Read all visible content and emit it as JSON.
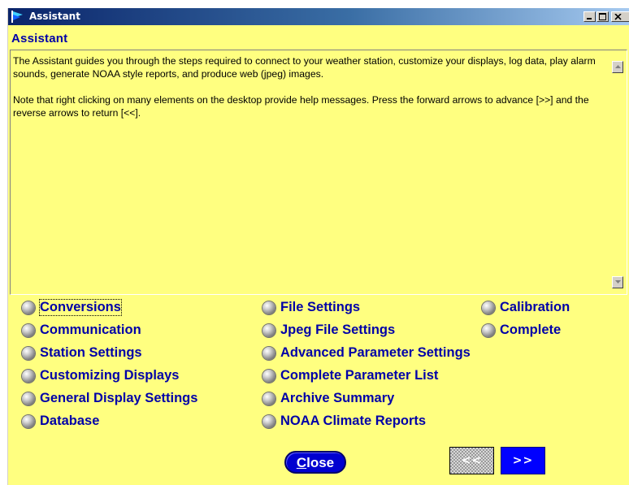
{
  "window": {
    "title": "Assistant"
  },
  "heading": "Assistant",
  "text": {
    "paragraph1": "The Assistant guides you through the steps required to connect to your weather station, customize your displays, log data, play alarm sounds, generate NOAA style reports, and produce web (jpeg) images.",
    "paragraph2": "Note that right clicking on many elements on the desktop provide help messages. Press the forward arrows to advance [>>] and the reverse arrows to return [<<]."
  },
  "topics": {
    "col1": [
      {
        "label": "Conversions",
        "focused": true
      },
      {
        "label": "Communication"
      },
      {
        "label": "Station Settings"
      },
      {
        "label": "Customizing Displays"
      },
      {
        "label": "General Display Settings"
      },
      {
        "label": "Database"
      }
    ],
    "col2": [
      {
        "label": "File Settings"
      },
      {
        "label": "Jpeg File Settings"
      },
      {
        "label": "Advanced Parameter Settings"
      },
      {
        "label": "Complete Parameter List"
      },
      {
        "label": "Archive Summary"
      },
      {
        "label": "NOAA Climate Reports"
      }
    ],
    "col3": [
      {
        "label": "Calibration"
      },
      {
        "label": "Complete"
      }
    ]
  },
  "buttons": {
    "close": "Close",
    "back": "<<",
    "forward": ">>"
  },
  "colors": {
    "background": "#ffff80",
    "link": "#0000a8",
    "button_blue": "#0000ff",
    "titlebar_start": "#0a246a"
  },
  "icons": {
    "app": "weather-flag-icon",
    "bullet": "radio-bullet-icon"
  }
}
